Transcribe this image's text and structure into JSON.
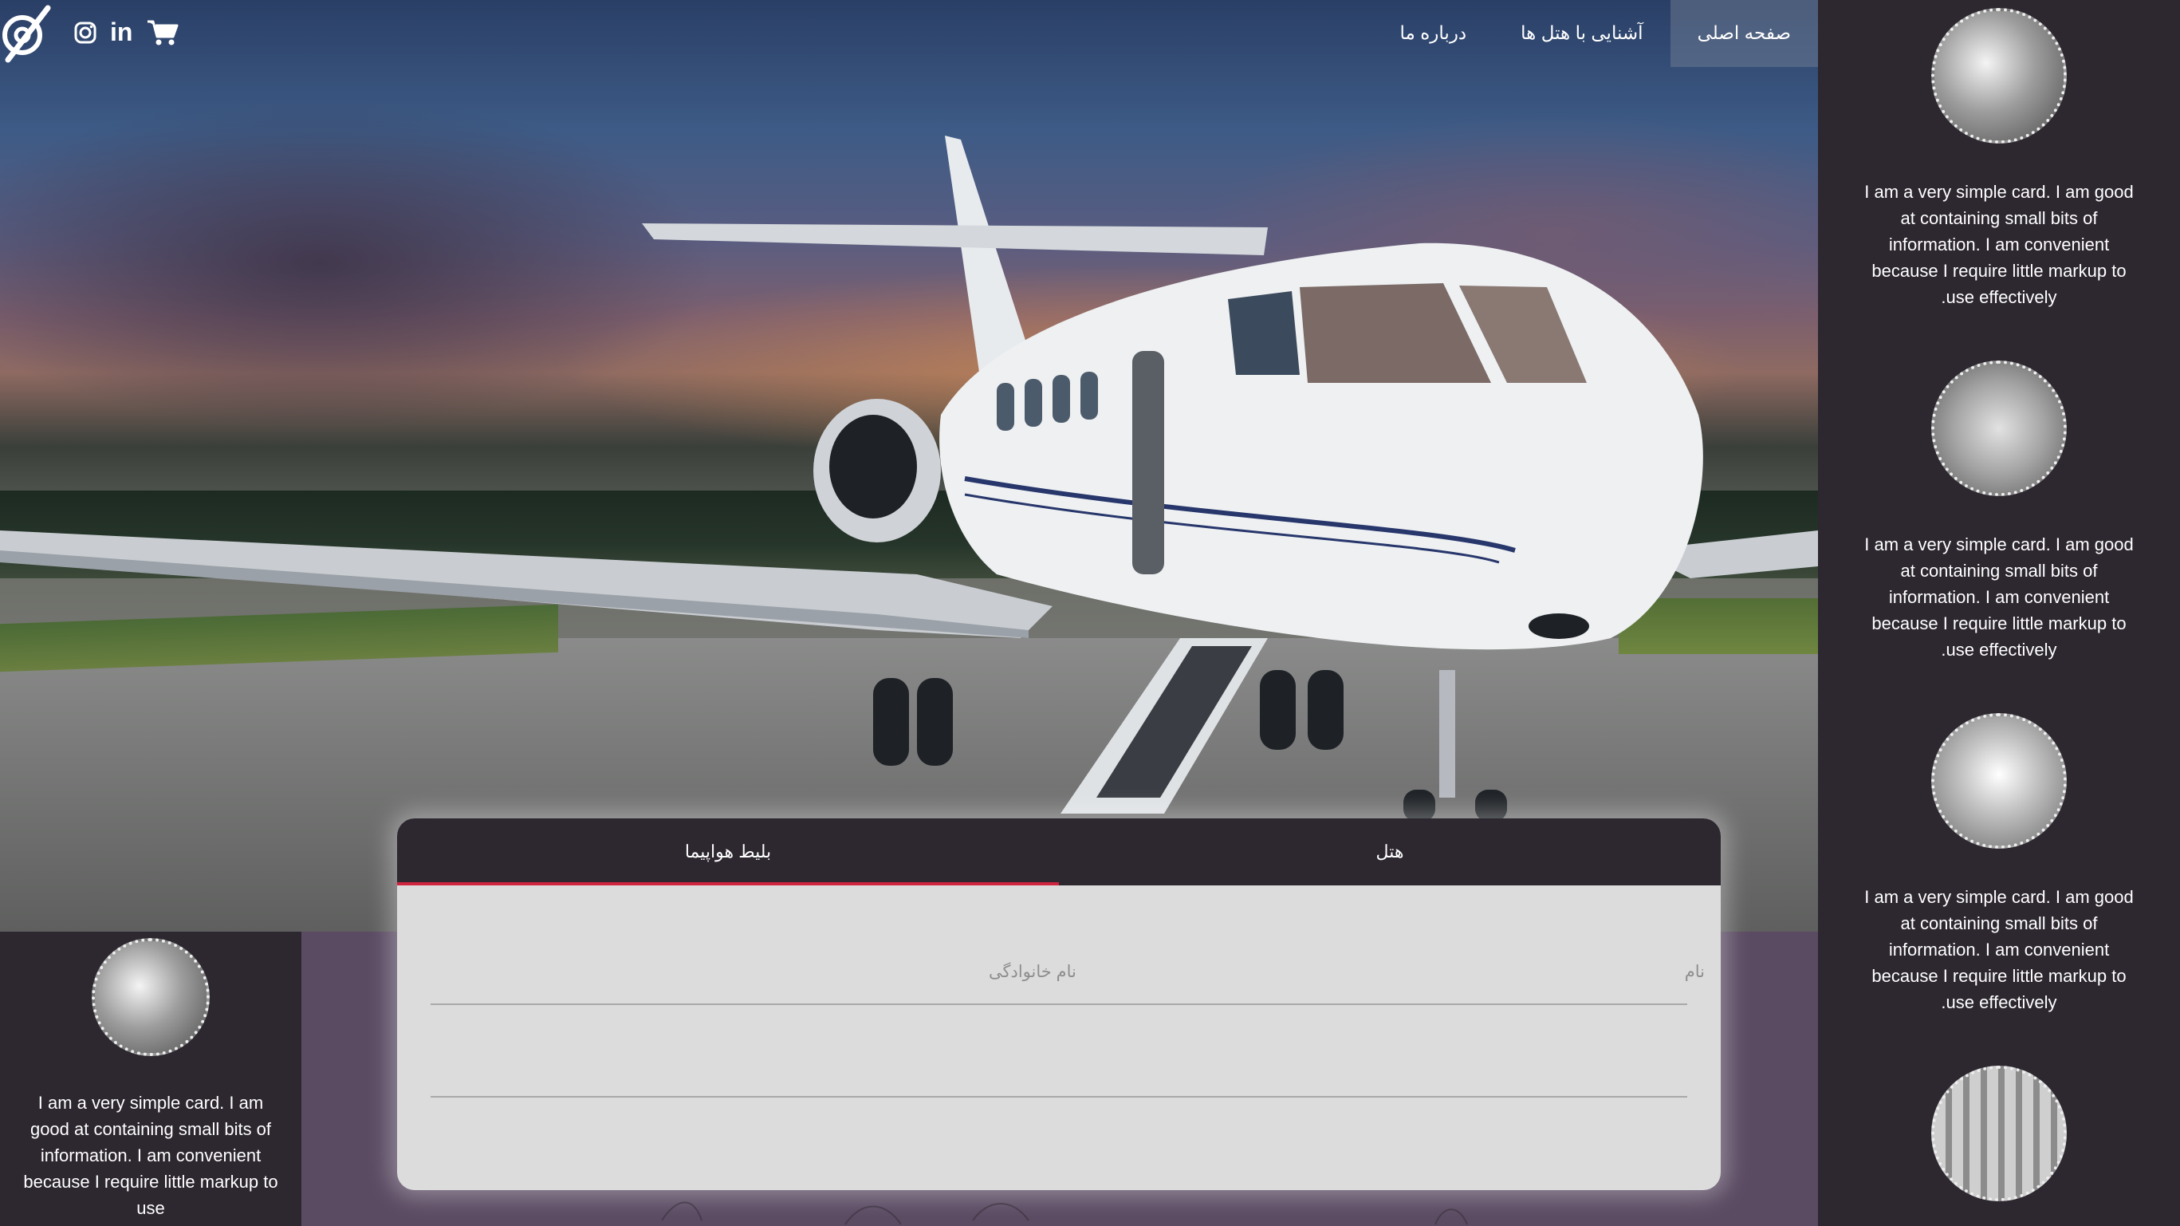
{
  "nav": {
    "items": [
      "صفحه اصلی",
      "آشنایی با هتل ها",
      "درباره ما"
    ],
    "active_index": 0
  },
  "social": {
    "icons": [
      "logo-icon",
      "instagram-icon",
      "linkedin-icon",
      "cart-icon"
    ],
    "linkedin_text": "in"
  },
  "sidebar": {
    "cards": [
      {
        "image": "jet-front-photo",
        "text": "I am a very simple card. I am good at containing small bits of information. I am convenient because I require little markup to use effectively."
      },
      {
        "image": "cabin-seat-photo",
        "text": "I am a very simple card. I am good at containing small bits of information. I am convenient because I require little markup to use effectively."
      },
      {
        "image": "airliner-front-photo",
        "text": "I am a very simple card. I am good at containing small bits of information. I am convenient because I require little markup to use effectively."
      },
      {
        "image": "cabin-interior-photo",
        "text": ""
      }
    ]
  },
  "left_card": {
    "image": "jet-front-photo",
    "text": "I am a very simple card. I am good at containing small bits of information. I am convenient because I require little markup to use"
  },
  "booking": {
    "tabs": [
      "بلیط هواپیما",
      "هتل"
    ],
    "active_tab": 0,
    "first_name_label": "نام",
    "last_name_label": "نام خانوادگی"
  },
  "colors": {
    "dark_panel": "#2d2730",
    "page_bg": "#5a4a62",
    "accent": "#d0233f",
    "form_bg": "#dcdcdc"
  }
}
